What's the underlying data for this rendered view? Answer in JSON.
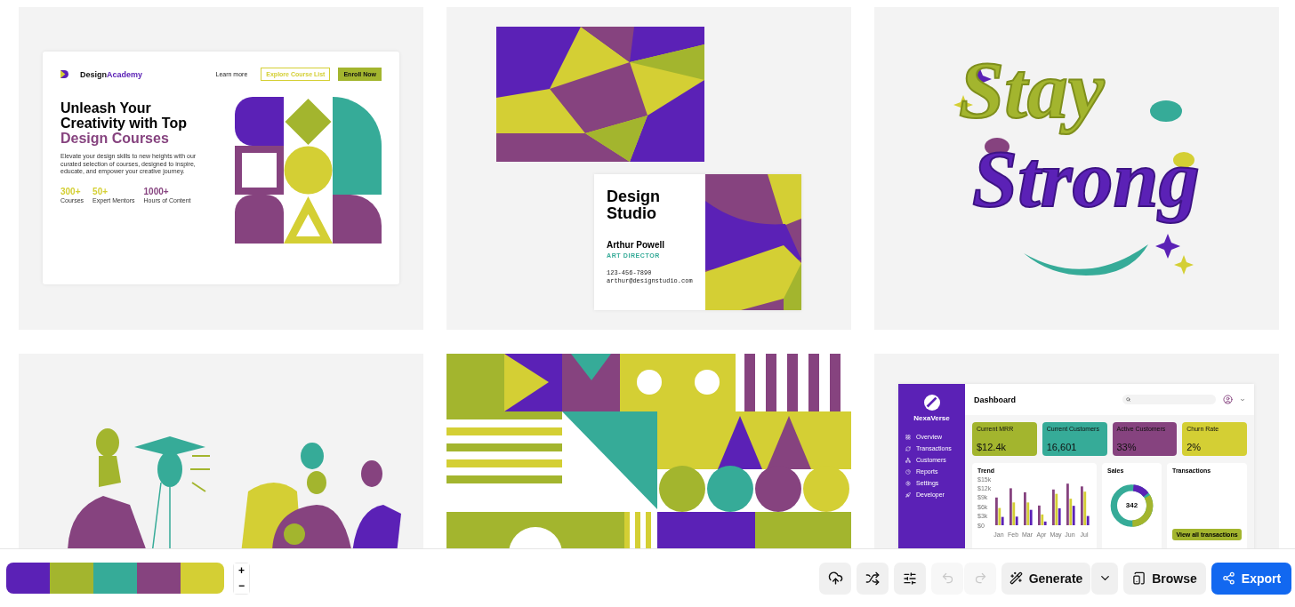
{
  "landing": {
    "brand": [
      "Design",
      "Academy"
    ],
    "nav": [
      "Learn more",
      "Explore Course List",
      "Enroll Now"
    ],
    "headline": "Unleash Your Creativity with Top ",
    "headline_accent": "Design Courses",
    "body": "Elevate your design skills to new heights with our curated selection of courses, designed to inspire, educate, and empower your creative journey.",
    "stats": [
      {
        "value": "300+",
        "label": "Courses",
        "color": "#d4cf34"
      },
      {
        "value": "50+",
        "label": "Expert Mentors",
        "color": "#d4cf34"
      },
      {
        "value": "1000+",
        "label": "Hours of Content",
        "color": "#86437f"
      }
    ]
  },
  "business_card": {
    "company": "Design Studio",
    "name": "Arthur Powell",
    "role": "ART DIRECTOR",
    "phone": "123-456-7890",
    "email": "arthur@designstudio.com"
  },
  "lettering": [
    "Stay",
    "Strong"
  ],
  "dashboard": {
    "brand": "NexaVerse",
    "title": "Dashboard",
    "menu": [
      "Overview",
      "Transactions",
      "Customers",
      "Reports",
      "Settings",
      "Developer"
    ],
    "metrics": [
      {
        "label": "Current MRR",
        "value": "$12.4k",
        "color": "#a3b52e"
      },
      {
        "label": "Current Customers",
        "value": "16,601",
        "color": "#36ab98"
      },
      {
        "label": "Active Customers",
        "value": "33%",
        "color": "#86437f"
      },
      {
        "label": "Churn Rate",
        "value": "2%",
        "color": "#d4cf34"
      }
    ],
    "trend": {
      "title": "Trend",
      "chart_data": {
        "type": "bar",
        "categories": [
          "Jan",
          "Feb",
          "Mar",
          "Apr",
          "May",
          "Jun",
          "Jul"
        ],
        "ylim": [
          0,
          15
        ],
        "yticks": [
          {
            "value": 0,
            "label": "$0"
          },
          {
            "value": 3,
            "label": "$3k"
          },
          {
            "value": 6,
            "label": "$6k"
          },
          {
            "value": 9,
            "label": "$9k"
          },
          {
            "value": 12,
            "label": "$12k"
          },
          {
            "value": 15,
            "label": "$15k"
          }
        ],
        "series": [
          {
            "color": "#86437f",
            "values": [
              9,
              12,
              10.7,
              6.4,
              11.6,
              13.5,
              12.6
            ]
          },
          {
            "color": "#d4cf34",
            "values": [
              5.6,
              7.4,
              7.4,
              3.5,
              10.2,
              8.6,
              10.9
            ]
          },
          {
            "color": "#5b21b6",
            "values": [
              2.7,
              2.8,
              5,
              1.2,
              5.5,
              6.3,
              3
            ]
          }
        ]
      }
    },
    "sales": {
      "title": "Sales",
      "total": "342"
    },
    "transactions": {
      "title": "Transactions",
      "button": "View all transactions"
    }
  },
  "palette": [
    {
      "color": "#5b21b6"
    },
    {
      "color": "#a3b52e"
    },
    {
      "color": "#36ab98"
    },
    {
      "color": "#86437f"
    },
    {
      "color": "#d4cf34"
    }
  ],
  "zoom": [
    "+",
    "−"
  ],
  "toolbar": {
    "undo_disabled": true,
    "redo_disabled": true,
    "generate": "Generate",
    "browse": "Browse",
    "export": "Export"
  }
}
